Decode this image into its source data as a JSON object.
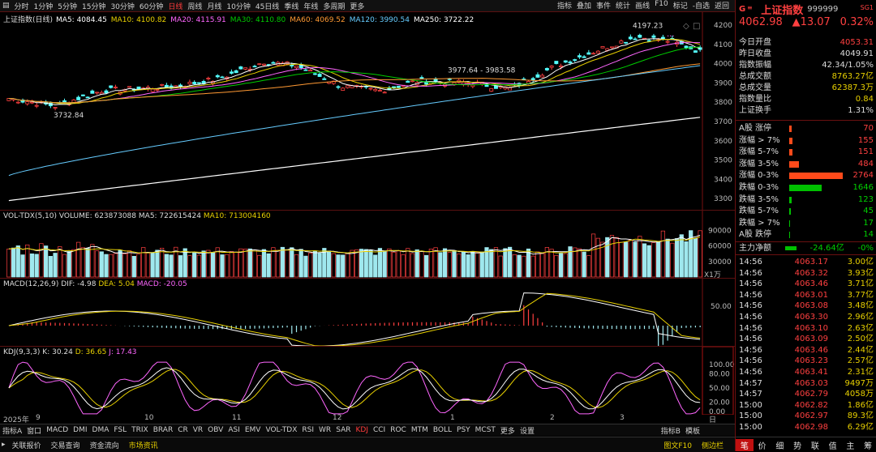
{
  "toolbar": {
    "periods": [
      "分时",
      "1分钟",
      "5分钟",
      "15分钟",
      "30分钟",
      "60分钟",
      "日线",
      "周线",
      "月线",
      "10分钟",
      "45日线",
      "季线",
      "年线",
      "多周期",
      "更多"
    ],
    "active_index": 6,
    "right": [
      "指标",
      "叠加",
      "事件",
      "统计",
      "画线",
      "F10",
      "标记",
      "-自选",
      "返回"
    ]
  },
  "main": {
    "title": "上证指数(日线)",
    "ma": [
      {
        "label": "MA5: 4084.45",
        "color": "#ffffff"
      },
      {
        "label": "MA10: 4100.82",
        "color": "#e8d000"
      },
      {
        "label": "MA20: 4115.91",
        "color": "#ff66ff"
      },
      {
        "label": "MA30: 4110.80",
        "color": "#00cc00"
      },
      {
        "label": "MA60: 4069.52",
        "color": "#ff9933"
      },
      {
        "label": "MA120: 3990.54",
        "color": "#66ccff"
      },
      {
        "label": "MA250: 3722.22",
        "color": "#ffffff"
      }
    ],
    "y_ticks": [
      "4200",
      "4100",
      "4000",
      "3900",
      "3800",
      "3700",
      "3600",
      "3500",
      "3400",
      "3300"
    ],
    "annotations": {
      "high": "4197.23",
      "mid": "3977.64 - 3983.58",
      "low": "3732.84"
    }
  },
  "volume": {
    "title": "VOL-TDX(5,10)",
    "volume": "VOLUME: 623873088",
    "ma5": "MA5: 722615424",
    "ma10": "MA10: 713004160",
    "y_ticks": [
      "90000",
      "60000",
      "30000"
    ],
    "unit": "X1万"
  },
  "macd": {
    "title": "MACD(12,26,9)",
    "dif": "DIF: -4.98",
    "dea": "DEA: 5.04",
    "macd": "MACD: -20.05",
    "y_ticks": [
      "50.00"
    ]
  },
  "kdj": {
    "title": "KDJ(9,3,3)",
    "k": "K: 30.24",
    "d": "D: 36.65",
    "j": "J: 17.43",
    "y_ticks": [
      "100.00",
      "80.00",
      "50.00",
      "20.00",
      "0.00"
    ]
  },
  "dates": {
    "year": "2025年",
    "labels": [
      "9",
      "10",
      "11",
      "12",
      "1",
      "2",
      "3"
    ],
    "right": "日线"
  },
  "bottom_tabs": [
    "指标A",
    "窗口",
    "MACD",
    "DMI",
    "DMA",
    "FSL",
    "TRIX",
    "BRAR",
    "CR",
    "VR",
    "OBV",
    "ASI",
    "EMV",
    "VOL-TDX",
    "RSI",
    "WR",
    "SAR",
    "KDJ",
    "CCI",
    "ROC",
    "MTM",
    "BOLL",
    "PSY",
    "MCST",
    "更多",
    "设置"
  ],
  "bottom_active": "KDJ",
  "bottom_right": [
    "指标B",
    "模板"
  ],
  "footer": {
    "items": [
      "关联报价",
      "交易查询",
      "资金流向",
      "市场资讯"
    ],
    "active": "市场资讯",
    "right": [
      "图文F10",
      "侧边栏"
    ]
  },
  "sidebar": {
    "logo": "G",
    "name": "上证指数",
    "code": "999999",
    "tag": "SG1",
    "price": "4062.98",
    "change": "▲13.07",
    "pct": "0.32%",
    "info": [
      {
        "k": "今日开盘",
        "v": "4053.31",
        "c": "red"
      },
      {
        "k": "昨日收盘",
        "v": "4049.91",
        "c": "white"
      },
      {
        "k": "指数振幅",
        "v": "42.34/1.05%",
        "c": "white"
      },
      {
        "k": "总成交额",
        "v": "8763.27亿",
        "c": "yellow"
      },
      {
        "k": "总成交量",
        "v": "62387.3万",
        "c": "yellow"
      },
      {
        "k": "指数量比",
        "v": "0.84",
        "c": "yellow"
      },
      {
        "k": "上证换手",
        "v": "1.31%",
        "c": "white"
      }
    ],
    "dist": [
      {
        "k": "A股 涨停",
        "v": "70",
        "bar": 3,
        "c": "red"
      },
      {
        "k": "涨幅 > 7%",
        "v": "155",
        "bar": 4,
        "c": "red"
      },
      {
        "k": "涨幅 5-7%",
        "v": "151",
        "bar": 4,
        "c": "red"
      },
      {
        "k": "涨幅 3-5%",
        "v": "484",
        "bar": 12,
        "c": "red"
      },
      {
        "k": "涨幅 0-3%",
        "v": "2764",
        "bar": 66,
        "c": "red"
      },
      {
        "k": "跌幅 0-3%",
        "v": "1646",
        "bar": 40,
        "c": "green"
      },
      {
        "k": "跌幅 3-5%",
        "v": "123",
        "bar": 3,
        "c": "green"
      },
      {
        "k": "跌幅 5-7%",
        "v": "45",
        "bar": 2,
        "c": "green"
      },
      {
        "k": "跌幅 > 7%",
        "v": "17",
        "bar": 1,
        "c": "green"
      },
      {
        "k": "A股 跌停",
        "v": "14",
        "bar": 1,
        "c": "green"
      }
    ],
    "flow": {
      "k": "主力净额",
      "v": "-24.64亿",
      "pct": "-0%"
    },
    "ticks": [
      {
        "t": "14:56",
        "p": "4063.17",
        "v": "3.00亿"
      },
      {
        "t": "14:56",
        "p": "4063.32",
        "v": "3.93亿"
      },
      {
        "t": "14:56",
        "p": "4063.46",
        "v": "3.71亿"
      },
      {
        "t": "14:56",
        "p": "4063.01",
        "v": "3.77亿"
      },
      {
        "t": "14:56",
        "p": "4063.08",
        "v": "3.48亿"
      },
      {
        "t": "14:56",
        "p": "4063.30",
        "v": "2.96亿"
      },
      {
        "t": "14:56",
        "p": "4063.10",
        "v": "2.63亿"
      },
      {
        "t": "14:56",
        "p": "4063.09",
        "v": "2.50亿"
      },
      {
        "t": "14:56",
        "p": "4063.46",
        "v": "2.44亿"
      },
      {
        "t": "14:56",
        "p": "4063.23",
        "v": "2.57亿"
      },
      {
        "t": "14:56",
        "p": "4063.41",
        "v": "2.31亿"
      },
      {
        "t": "14:57",
        "p": "4063.03",
        "v": "9497万"
      },
      {
        "t": "14:57",
        "p": "4062.79",
        "v": "4058万"
      },
      {
        "t": "15:00",
        "p": "4062.82",
        "v": "1.86亿"
      },
      {
        "t": "15:00",
        "p": "4062.97",
        "v": "89.3亿"
      },
      {
        "t": "15:00",
        "p": "4062.98",
        "v": "6.29亿"
      }
    ],
    "bottom_tabs": [
      "笔",
      "价",
      "细",
      "势",
      "联",
      "值",
      "主",
      "筹"
    ]
  }
}
